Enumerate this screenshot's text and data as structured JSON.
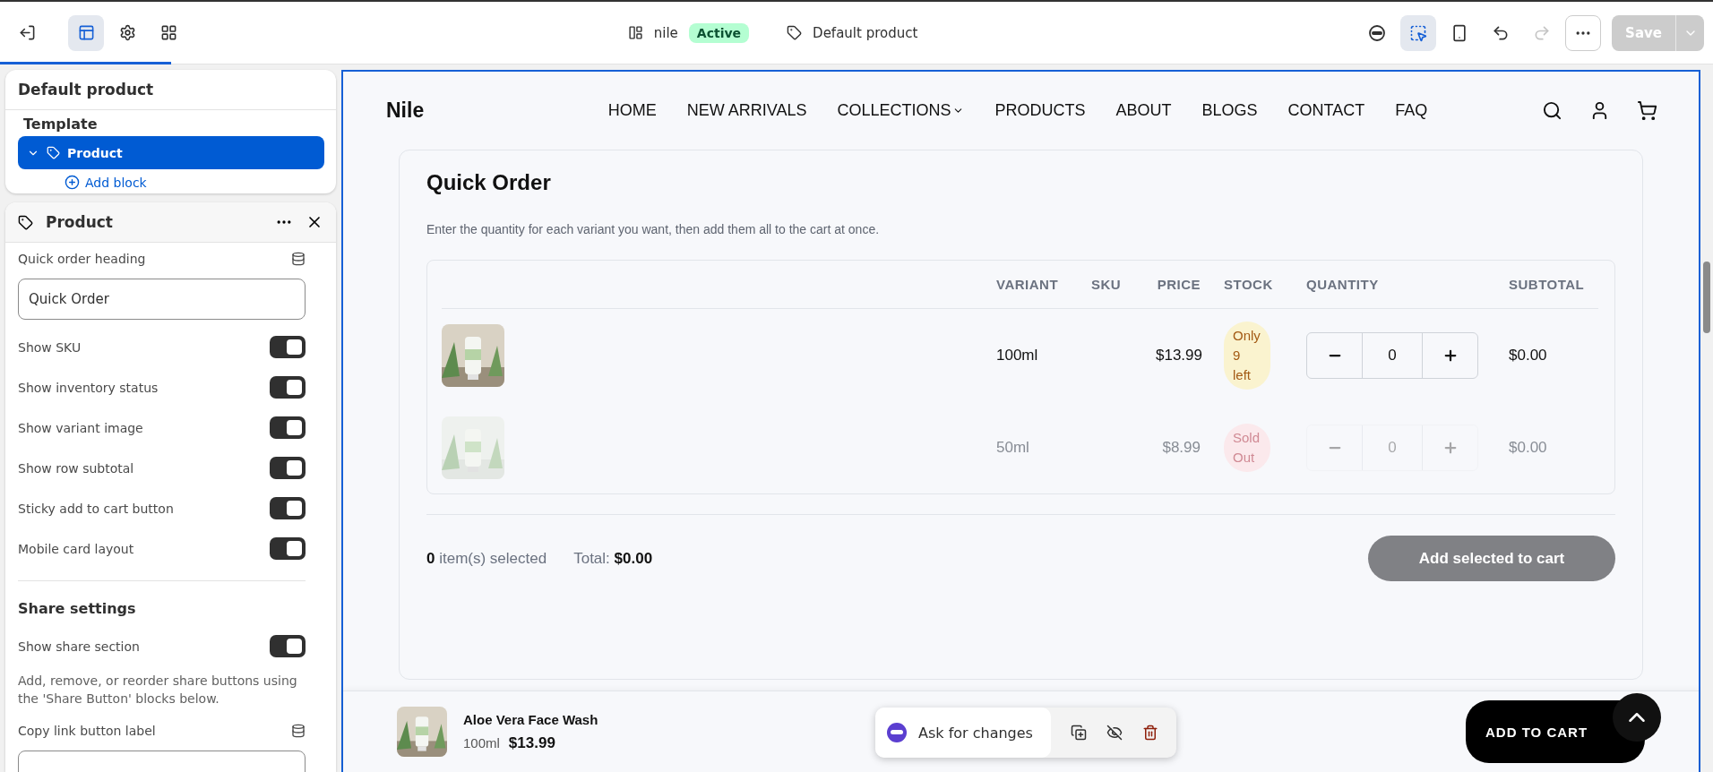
{
  "topbar": {
    "loading": {
      "level": 0.1
    },
    "left_tools": [
      {
        "selected": false
      },
      {
        "selected": true
      },
      {
        "selected": false
      },
      {
        "selected": false
      }
    ],
    "theme_name": "nile",
    "status": "Active",
    "template": "Default product",
    "right_tools": [
      {
        "selected": false,
        "disabled": false
      },
      {
        "selected": true,
        "disabled": false
      },
      {
        "selected": false,
        "disabled": false
      },
      {
        "selected": false,
        "disabled": false
      },
      {
        "selected": false,
        "disabled": true
      },
      {
        "selected": false,
        "disabled": false
      }
    ],
    "save": {
      "label": "Save",
      "disabled": true
    }
  },
  "template_panel": {
    "title": "Default product",
    "section": "Template",
    "item": {
      "label": "Product",
      "expanded": true,
      "selected": true
    },
    "add_block": "Add block"
  },
  "settings_panel": {
    "title": "Product",
    "fields": [
      {
        "kind": "text",
        "label": "Quick order heading",
        "value": "Quick Order"
      },
      {
        "kind": "toggle",
        "label": "Show SKU",
        "on": true
      },
      {
        "kind": "toggle",
        "label": "Show inventory status",
        "on": true
      },
      {
        "kind": "toggle",
        "label": "Show variant image",
        "on": true
      },
      {
        "kind": "toggle",
        "label": "Show row subtotal",
        "on": true
      },
      {
        "kind": "toggle",
        "label": "Sticky add to cart button",
        "on": true
      },
      {
        "kind": "toggle",
        "label": "Mobile card layout",
        "on": true
      },
      {
        "kind": "heading",
        "label": "Share settings"
      },
      {
        "kind": "toggle",
        "label": "Show share section",
        "on": true
      },
      {
        "kind": "note",
        "label": "Add, remove, or reorder share buttons using the 'Share Button' blocks below."
      },
      {
        "kind": "text",
        "label": "Copy link button label"
      }
    ]
  },
  "store": {
    "logo": "Nile",
    "nav": [
      {
        "label": "HOME",
        "dropdown": false
      },
      {
        "label": "NEW ARRIVALS",
        "dropdown": false
      },
      {
        "label": "COLLECTIONS",
        "dropdown": true
      },
      {
        "label": "PRODUCTS",
        "dropdown": false
      },
      {
        "label": "ABOUT",
        "dropdown": false
      },
      {
        "label": "BLOGS",
        "dropdown": false
      },
      {
        "label": "CONTACT",
        "dropdown": false
      },
      {
        "label": "FAQ",
        "dropdown": false
      }
    ]
  },
  "quick_order": {
    "title": "Quick Order",
    "description": "Enter the quantity for each variant you want, then add them all to the cart at once.",
    "columns": [
      "VARIANT",
      "SKU",
      "PRICE",
      "STOCK",
      "QUANTITY",
      "SUBTOTAL"
    ],
    "rows": [
      {
        "variant": "100ml",
        "price": "$13.99",
        "stock": "Only 9 left",
        "sold_out": false,
        "quantity": "0",
        "subtotal": "$0.00",
        "disabled": false
      },
      {
        "variant": "50ml",
        "price": "$8.99",
        "stock": "Sold Out",
        "sold_out": true,
        "quantity": "0",
        "subtotal": "$0.00",
        "disabled": true
      }
    ],
    "count": "0",
    "count_label": "item(s) selected",
    "total_label": "Total:",
    "total": "$0.00",
    "button": {
      "label": "Add selected to cart",
      "disabled": true
    }
  },
  "sticky_bar": {
    "name": "Aloe Vera Face Wash",
    "variant": "100ml",
    "price": "$13.99",
    "button": "ADD TO CART"
  },
  "floating_toolbar": {
    "ask": "Ask for changes"
  }
}
